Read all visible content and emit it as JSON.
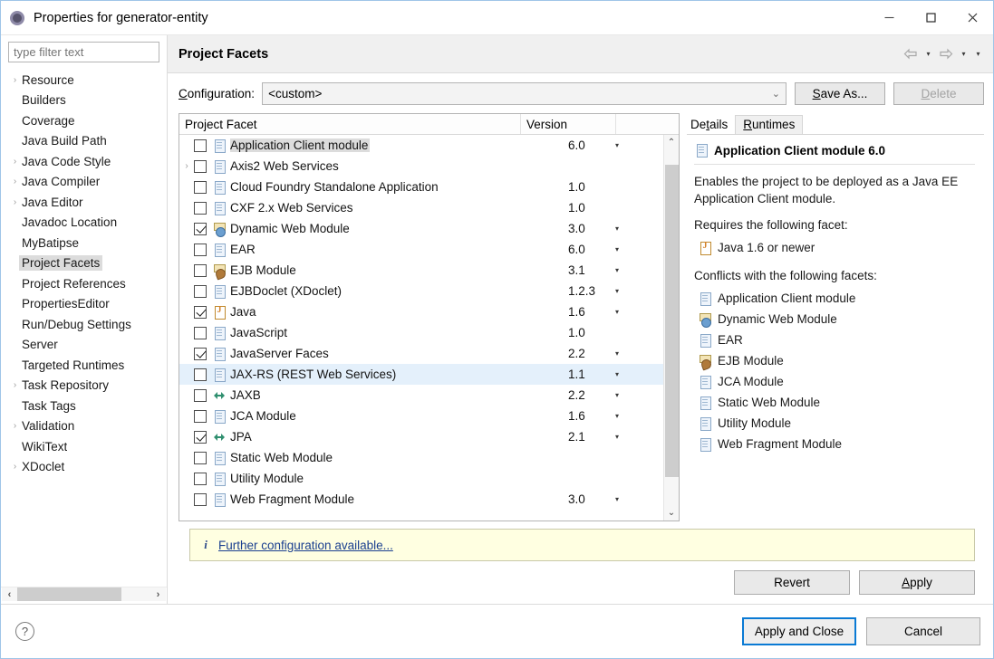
{
  "window": {
    "title": "Properties for generator-entity",
    "icon": "gear-icon",
    "minimize": "—",
    "maximize": "□",
    "close": "✕"
  },
  "sidebar": {
    "filter_placeholder": "type filter text",
    "filter_value": "",
    "items": [
      {
        "label": "Resource",
        "expandable": true,
        "selected": false
      },
      {
        "label": "Builders",
        "expandable": false,
        "selected": false
      },
      {
        "label": "Coverage",
        "expandable": false,
        "selected": false
      },
      {
        "label": "Java Build Path",
        "expandable": false,
        "selected": false
      },
      {
        "label": "Java Code Style",
        "expandable": true,
        "selected": false
      },
      {
        "label": "Java Compiler",
        "expandable": true,
        "selected": false
      },
      {
        "label": "Java Editor",
        "expandable": true,
        "selected": false
      },
      {
        "label": "Javadoc Location",
        "expandable": false,
        "selected": false
      },
      {
        "label": "MyBatipse",
        "expandable": false,
        "selected": false
      },
      {
        "label": "Project Facets",
        "expandable": false,
        "selected": true
      },
      {
        "label": "Project References",
        "expandable": false,
        "selected": false
      },
      {
        "label": "PropertiesEditor",
        "expandable": false,
        "selected": false
      },
      {
        "label": "Run/Debug Settings",
        "expandable": false,
        "selected": false
      },
      {
        "label": "Server",
        "expandable": false,
        "selected": false
      },
      {
        "label": "Targeted Runtimes",
        "expandable": false,
        "selected": false
      },
      {
        "label": "Task Repository",
        "expandable": true,
        "selected": false
      },
      {
        "label": "Task Tags",
        "expandable": false,
        "selected": false
      },
      {
        "label": "Validation",
        "expandable": true,
        "selected": false
      },
      {
        "label": "WikiText",
        "expandable": false,
        "selected": false
      },
      {
        "label": "XDoclet",
        "expandable": true,
        "selected": false
      }
    ],
    "hscroll_left": "‹",
    "hscroll_right": "›"
  },
  "page": {
    "title": "Project Facets",
    "nav_back": "back-arrow-icon",
    "nav_forward": "forward-arrow-icon",
    "caret": "▾"
  },
  "configuration": {
    "label": "Configuration:",
    "label_mnemonic": "C",
    "value": "<custom>",
    "caret": "⌄",
    "save_as_label": "Save As...",
    "save_as_mnemonic": "S",
    "delete_label": "Delete",
    "delete_mnemonic": "D",
    "delete_disabled": true
  },
  "facets_table": {
    "columns": [
      "Project Facet",
      "Version"
    ],
    "rows": [
      {
        "name": "Application Client module",
        "version": "6.0",
        "checked": false,
        "has_version_caret": true,
        "icon": "document-icon",
        "expandable": false,
        "selected": true,
        "hovered": false
      },
      {
        "name": "Axis2 Web Services",
        "version": "",
        "checked": false,
        "has_version_caret": false,
        "icon": "document-icon",
        "expandable": true,
        "selected": false,
        "hovered": false
      },
      {
        "name": "Cloud Foundry Standalone Application",
        "version": "1.0",
        "checked": false,
        "has_version_caret": false,
        "icon": "document-icon",
        "expandable": false,
        "selected": false,
        "hovered": false
      },
      {
        "name": "CXF 2.x Web Services",
        "version": "1.0",
        "checked": false,
        "has_version_caret": false,
        "icon": "document-icon",
        "expandable": false,
        "selected": false,
        "hovered": false
      },
      {
        "name": "Dynamic Web Module",
        "version": "3.0",
        "checked": true,
        "has_version_caret": true,
        "icon": "web-module-icon",
        "expandable": false,
        "selected": false,
        "hovered": false
      },
      {
        "name": "EAR",
        "version": "6.0",
        "checked": false,
        "has_version_caret": true,
        "icon": "document-icon",
        "expandable": false,
        "selected": false,
        "hovered": false
      },
      {
        "name": "EJB Module",
        "version": "3.1",
        "checked": false,
        "has_version_caret": true,
        "icon": "ejb-module-icon",
        "expandable": false,
        "selected": false,
        "hovered": false
      },
      {
        "name": "EJBDoclet (XDoclet)",
        "version": "1.2.3",
        "checked": false,
        "has_version_caret": true,
        "icon": "document-icon",
        "expandable": false,
        "selected": false,
        "hovered": false
      },
      {
        "name": "Java",
        "version": "1.6",
        "checked": true,
        "has_version_caret": true,
        "icon": "java-icon",
        "expandable": false,
        "selected": false,
        "hovered": false
      },
      {
        "name": "JavaScript",
        "version": "1.0",
        "checked": false,
        "has_version_caret": false,
        "icon": "document-icon",
        "expandable": false,
        "selected": false,
        "hovered": false
      },
      {
        "name": "JavaServer Faces",
        "version": "2.2",
        "checked": true,
        "has_version_caret": true,
        "icon": "document-icon",
        "expandable": false,
        "selected": false,
        "hovered": false
      },
      {
        "name": "JAX-RS (REST Web Services)",
        "version": "1.1",
        "checked": false,
        "has_version_caret": true,
        "icon": "document-icon",
        "expandable": false,
        "selected": false,
        "hovered": true
      },
      {
        "name": "JAXB",
        "version": "2.2",
        "checked": false,
        "has_version_caret": true,
        "icon": "arrows-icon",
        "expandable": false,
        "selected": false,
        "hovered": false
      },
      {
        "name": "JCA Module",
        "version": "1.6",
        "checked": false,
        "has_version_caret": true,
        "icon": "document-icon",
        "expandable": false,
        "selected": false,
        "hovered": false
      },
      {
        "name": "JPA",
        "version": "2.1",
        "checked": true,
        "has_version_caret": true,
        "icon": "arrows-icon",
        "expandable": false,
        "selected": false,
        "hovered": false
      },
      {
        "name": "Static Web Module",
        "version": "",
        "checked": false,
        "has_version_caret": false,
        "icon": "document-icon",
        "expandable": false,
        "selected": false,
        "hovered": false
      },
      {
        "name": "Utility Module",
        "version": "",
        "checked": false,
        "has_version_caret": false,
        "icon": "document-icon",
        "expandable": false,
        "selected": false,
        "hovered": false
      },
      {
        "name": "Web Fragment Module",
        "version": "3.0",
        "checked": false,
        "has_version_caret": true,
        "icon": "document-icon",
        "expandable": false,
        "selected": false,
        "hovered": false
      }
    ],
    "scroll_up": "⌃",
    "scroll_down": "⌄"
  },
  "details": {
    "tabs": [
      {
        "label": "Details",
        "mnemonic": "t",
        "active": true
      },
      {
        "label": "Runtimes",
        "mnemonic": "R",
        "active": false
      }
    ],
    "heading": "Application Client module 6.0",
    "heading_icon": "document-icon",
    "description": "Enables the project to be deployed as a Java EE Application Client module.",
    "requires_label": "Requires the following facet:",
    "requires": [
      {
        "label": "Java 1.6 or newer",
        "icon": "java-icon"
      }
    ],
    "conflicts_label": "Conflicts with the following facets:",
    "conflicts": [
      {
        "label": "Application Client module",
        "icon": "document-icon"
      },
      {
        "label": "Dynamic Web Module",
        "icon": "web-module-icon"
      },
      {
        "label": "EAR",
        "icon": "document-icon"
      },
      {
        "label": "EJB Module",
        "icon": "ejb-module-icon"
      },
      {
        "label": "JCA Module",
        "icon": "document-icon"
      },
      {
        "label": "Static Web Module",
        "icon": "document-icon"
      },
      {
        "label": "Utility Module",
        "icon": "document-icon"
      },
      {
        "label": "Web Fragment Module",
        "icon": "document-icon"
      }
    ]
  },
  "info_bar": {
    "icon": "info-icon",
    "link_text": "Further configuration available..."
  },
  "action_buttons": {
    "revert": "Revert",
    "apply": "Apply",
    "apply_mnemonic": "A"
  },
  "footer": {
    "help": "?",
    "apply_and_close": "Apply and Close",
    "cancel": "Cancel"
  },
  "colors": {
    "accent_blue": "#0a7ad4",
    "hover_row": "#e4f0fb",
    "selection_gray": "#dcdcdc",
    "info_bg": "#ffffe1",
    "header_bg": "#f0f0f0",
    "link": "#1a3f8f"
  }
}
